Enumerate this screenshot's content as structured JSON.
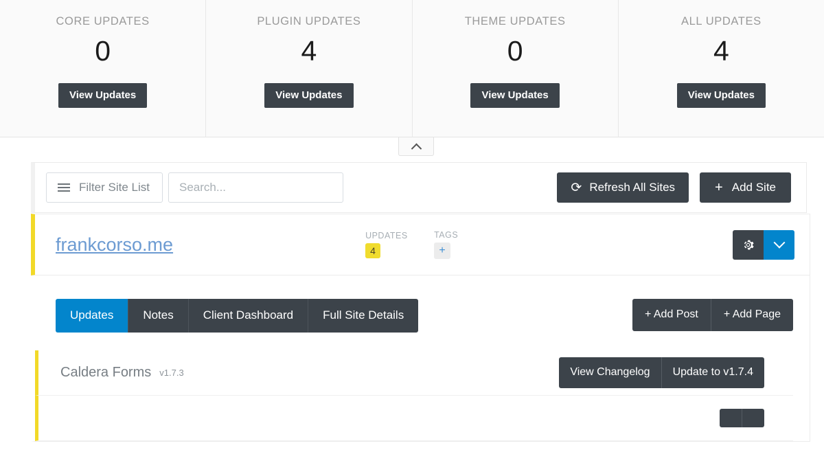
{
  "stats": {
    "cards": [
      {
        "label": "CORE UPDATES",
        "value": "0",
        "button": "View Updates"
      },
      {
        "label": "PLUGIN UPDATES",
        "value": "4",
        "button": "View Updates"
      },
      {
        "label": "THEME UPDATES",
        "value": "0",
        "button": "View Updates"
      },
      {
        "label": "ALL UPDATES",
        "value": "4",
        "button": "View Updates"
      }
    ],
    "collapse_icon": "chevron-up-icon"
  },
  "toolbar": {
    "filter_label": "Filter Site List",
    "filter_icon": "hamburger-icon",
    "search_placeholder": "Search...",
    "search_value": "",
    "refresh_label": "Refresh All Sites",
    "refresh_icon": "refresh-icon",
    "refresh_glyph": "⟳",
    "add_site_label": "Add Site",
    "add_site_glyph": "+"
  },
  "site": {
    "name": "frankcorso.me",
    "updates_label": "UPDATES",
    "updates_count": "4",
    "tags_label": "TAGS",
    "tags_add_glyph": "+",
    "gear_icon": "gear-icon",
    "caret_icon": "chevron-down-icon",
    "accent_color": "#f2d928",
    "link_color": "#6c9bd2"
  },
  "details": {
    "tabs": [
      {
        "label": "Updates",
        "active": true
      },
      {
        "label": "Notes",
        "active": false
      },
      {
        "label": "Client Dashboard",
        "active": false
      },
      {
        "label": "Full Site Details",
        "active": false
      }
    ],
    "add_buttons": [
      {
        "label": "+ Add Post"
      },
      {
        "label": "+ Add Page"
      }
    ],
    "plugins": [
      {
        "name": "Caldera Forms",
        "version": "v1.7.3",
        "changelog_label": "View Changelog",
        "update_label": "Update to v1.7.4"
      },
      {
        "name": "",
        "version": "",
        "changelog_label": "",
        "update_label": ""
      }
    ]
  },
  "colors": {
    "dark": "#3c434a",
    "blue": "#0385cc",
    "yellow": "#f0dc2e"
  }
}
